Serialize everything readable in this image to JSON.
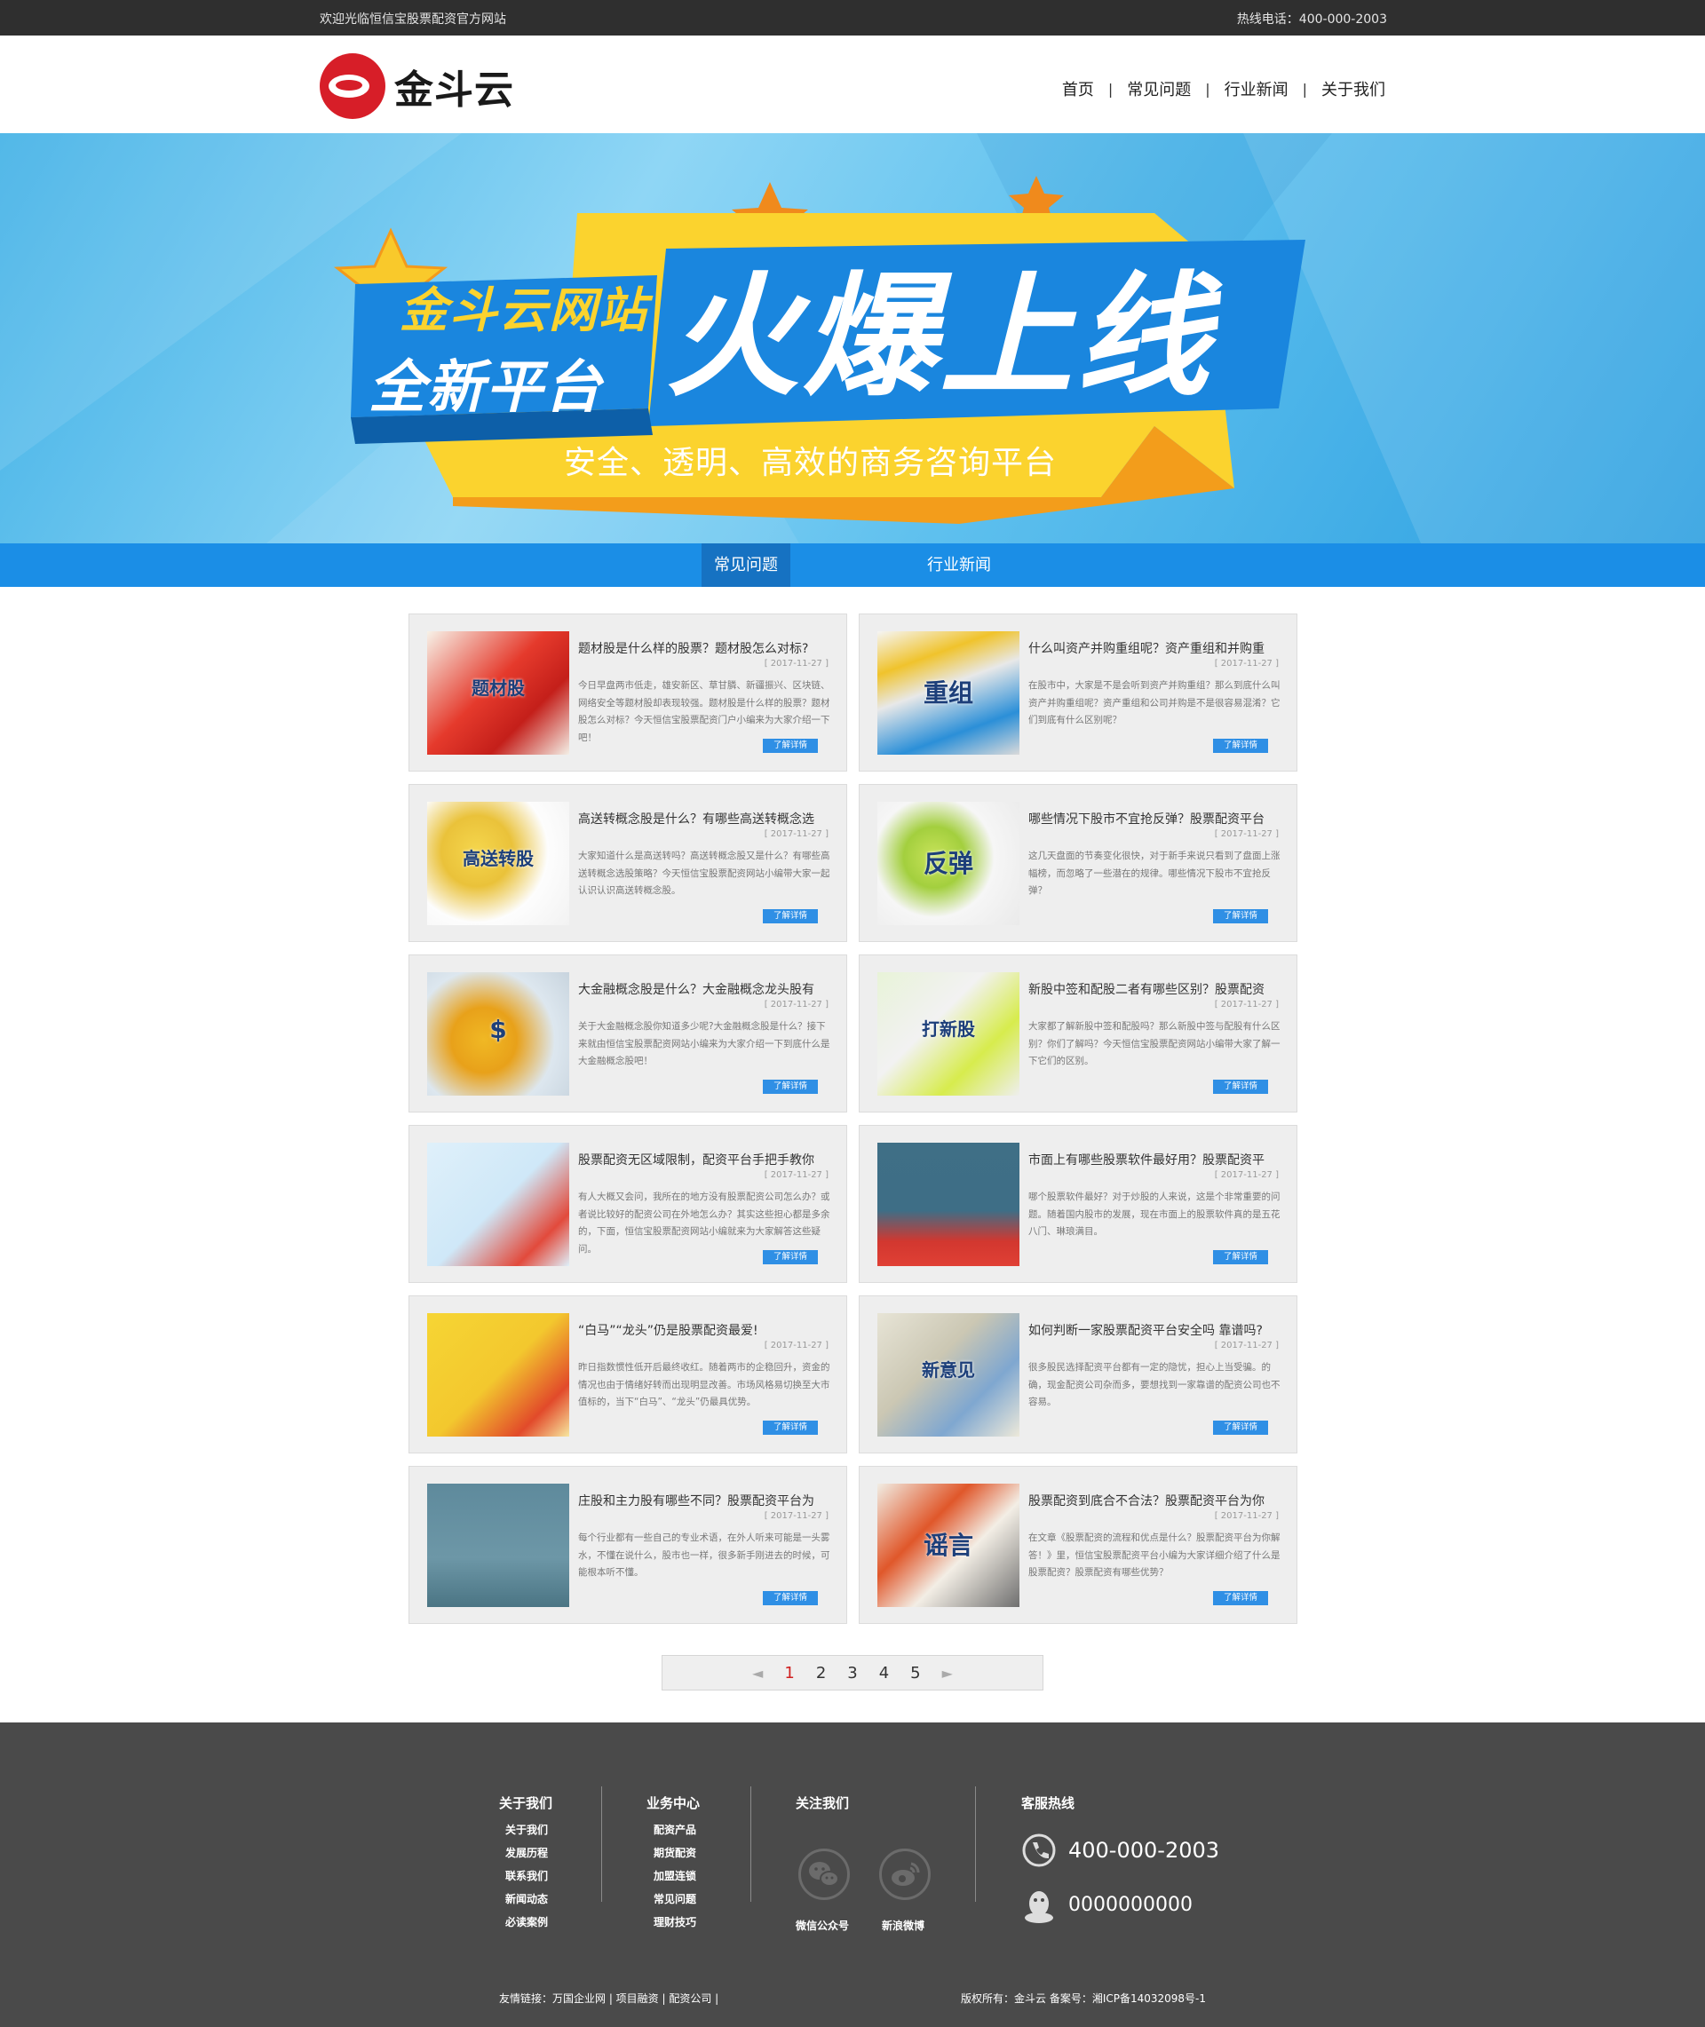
{
  "topbar": {
    "welcome": "欢迎光临恒信宝股票配资官方网站",
    "hotline": "热线电话：400-000-2003"
  },
  "header": {
    "logo_text": "金斗云",
    "nav": [
      "首页",
      "常见问题",
      "行业新闻",
      "关于我们"
    ],
    "nav_sep": "|"
  },
  "banner": {
    "line1": "金斗云网站",
    "line2": "全新平台",
    "headline": "火爆上线",
    "subline": "安全、透明、高效的商务咨询平台"
  },
  "tabs": [
    "常见问题",
    "行业新闻"
  ],
  "articles": [
    {
      "title": "题材股是什么样的股票？题材股怎么对标?",
      "date": "[ 2017-11-27 ]",
      "desc": "今日早盘两市低走，雄安新区、草甘膦、新疆振兴、区块链、网络安全等题材股却表现较强。题材股是什么样的股票？题材股怎么对标？今天恒信宝股票配资门户小编来为大家介绍一下吧！",
      "btn": "了解详情",
      "thumb_text": "题材股"
    },
    {
      "title": "什么叫资产并购重组呢？资产重组和并购重",
      "date": "[ 2017-11-27 ]",
      "desc": "在股市中，大家是不是会听到资产并购重组？那么到底什么叫资产并购重组呢？资产重组和公司并购是不是很容易混淆？它们到底有什么区别呢？",
      "btn": "了解详情",
      "thumb_text": "重组"
    },
    {
      "title": "高送转概念股是什么？有哪些高送转概念选",
      "date": "[ 2017-11-27 ]",
      "desc": "大家知道什么是高送转吗？高送转概念股又是什么？有哪些高送转概念选股策略？今天恒信宝股票配资网站小编带大家一起认识认识高送转概念股。",
      "btn": "了解详情",
      "thumb_text": "高送转股"
    },
    {
      "title": "哪些情况下股市不宜抢反弹？股票配资平台",
      "date": "[ 2017-11-27 ]",
      "desc": "这几天盘面的节奏变化很快，对于新手来说只看到了盘面上涨幅榜，而忽略了一些潜在的规律。哪些情况下股市不宜抢反弹？",
      "btn": "了解详情",
      "thumb_text": "反弹"
    },
    {
      "title": "大金融概念股是什么？大金融概念龙头股有",
      "date": "[ 2017-11-27 ]",
      "desc": "关于大金融概念股你知道多少呢?大金融概念股是什么？接下来就由恒信宝股票配资网站小编来为大家介绍一下到底什么是大金融概念股吧！",
      "btn": "了解详情",
      "thumb_text": "$"
    },
    {
      "title": "新股中签和配股二者有哪些区别？股票配资",
      "date": "[ 2017-11-27 ]",
      "desc": "大家都了解新股中签和配股吗？那么新股中签与配股有什么区别？你们了解吗？今天恒信宝股票配资网站小编带大家了解一下它们的区别。",
      "btn": "了解详情",
      "thumb_text": "打新股"
    },
    {
      "title": "股票配资无区域限制，配资平台手把手教你",
      "date": "[ 2017-11-27 ]",
      "desc": "有人大概又会问，我所在的地方没有股票配资公司怎么办？或者说比较好的配资公司在外地怎么办？其实这些担心都是多余的，下面，恒信宝股票配资网站小编就来为大家解答这些疑问。",
      "btn": "了解详情",
      "thumb_text": ""
    },
    {
      "title": "市面上有哪些股票软件最好用？股票配资平",
      "date": "[ 2017-11-27 ]",
      "desc": "哪个股票软件最好？对于炒股的人来说，这是个非常重要的问题。随着国内股市的发展，现在市面上的股票软件真的是五花八门、琳琅满目。",
      "btn": "了解详情",
      "thumb_text": ""
    },
    {
      "title": "“白马”“龙头”仍是股票配资最爱!",
      "date": "[ 2017-11-27 ]",
      "desc": "昨日指数惯性低开后最终收红。随着两市的企稳回升，资金的情况也由于情绪好转而出现明显改善。市场风格易切换至大市值标的，当下“白马”、“龙头”仍最具优势。",
      "btn": "了解详情",
      "thumb_text": ""
    },
    {
      "title": "如何判断一家股票配资平台安全吗 靠谱吗?",
      "date": "[ 2017-11-27 ]",
      "desc": "很多股民选择配资平台都有一定的隐忧，担心上当受骗。的确，现金配资公司杂而多，要想找到一家靠谱的配资公司也不容易。",
      "btn": "了解详情",
      "thumb_text": "新意见"
    },
    {
      "title": "庄股和主力股有哪些不同？股票配资平台为",
      "date": "[ 2017-11-27 ]",
      "desc": "每个行业都有一些自己的专业术语，在外人听来可能是一头雾水，不懂在说什么，股市也一样，很多新手刚进去的时候，可能根本听不懂。",
      "btn": "了解详情",
      "thumb_text": ""
    },
    {
      "title": "股票配资到底合不合法？股票配资平台为你",
      "date": "[ 2017-11-27 ]",
      "desc": "在文章《股票配资的流程和优点是什么？股票配资平台为你解答！》里，恒信宝股票配资平台小编为大家详细介绍了什么是股票配资？股票配资有哪些优势？",
      "btn": "了解详情",
      "thumb_text": "谣言"
    }
  ],
  "pager": {
    "prev": "◄",
    "pages": [
      "1",
      "2",
      "3",
      "4",
      "5"
    ],
    "current": "1",
    "next": "►"
  },
  "footer": {
    "about_title": "关于我们",
    "about_links": [
      "关于我们",
      "发展历程",
      "联系我们",
      "新闻动态",
      "必读案例"
    ],
    "biz_title": "业务中心",
    "biz_links": [
      "配资产品",
      "期货配资",
      "加盟连锁",
      "常见问题",
      "理财技巧"
    ],
    "follow_title": "关注我们",
    "wechat": "微信公众号",
    "weibo": "新浪微博",
    "service_title": "客服热线",
    "phone": "400-000-2003",
    "qq": "0000000000",
    "friend_links": "友情链接：万国企业网 | 项目融资 | 配资公司 |",
    "copyright": "版权所有：金斗云   备案号：湘ICP备14032098号-1"
  },
  "colors": {
    "brand_red": "#d71e28",
    "brand_blue": "#1b8ee6",
    "footer_bg": "#4a4a4a"
  }
}
